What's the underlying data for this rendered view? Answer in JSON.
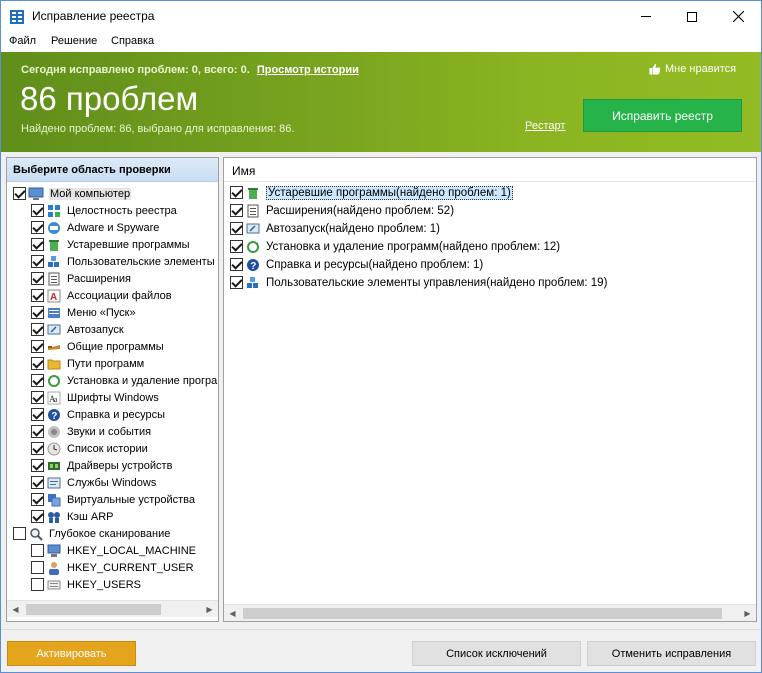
{
  "window": {
    "title": "Исправление реестра"
  },
  "menu": [
    "Файл",
    "Решение",
    "Справка"
  ],
  "banner": {
    "today_text": "Сегодня исправлено проблем: 0, всего: 0.",
    "history_link": "Просмотр истории",
    "problem_count": "86 проблем",
    "found_text": "Найдено проблем: 86, выбрано для исправления: 86.",
    "like_label": "Мне нравится",
    "restart_link": "Рестарт",
    "fix_button": "Исправить реестр"
  },
  "left_panel": {
    "header": "Выберите область проверки",
    "root": {
      "label": "Мой компьютер",
      "checked": true,
      "icon": "computer-icon"
    },
    "items": [
      {
        "label": "Целостность реестра",
        "checked": true,
        "icon": "registry-icon"
      },
      {
        "label": "Adware и Spyware",
        "checked": true,
        "icon": "adware-icon"
      },
      {
        "label": "Устаревшие программы",
        "checked": true,
        "icon": "trash-icon"
      },
      {
        "label": "Пользовательские элементы у",
        "checked": true,
        "icon": "blocks-icon"
      },
      {
        "label": "Расширения",
        "checked": true,
        "icon": "extensions-icon"
      },
      {
        "label": "Ассоциации файлов",
        "checked": true,
        "icon": "file-association-icon"
      },
      {
        "label": "Меню «Пуск»",
        "checked": true,
        "icon": "start-menu-icon"
      },
      {
        "label": "Автозапуск",
        "checked": true,
        "icon": "autorun-icon"
      },
      {
        "label": "Общие программы",
        "checked": true,
        "icon": "shared-programs-icon"
      },
      {
        "label": "Пути программ",
        "checked": true,
        "icon": "folder-icon"
      },
      {
        "label": "Установка и удаление програ",
        "checked": true,
        "icon": "recycle-icon"
      },
      {
        "label": "Шрифты Windows",
        "checked": true,
        "icon": "fonts-icon"
      },
      {
        "label": "Справка и ресурсы",
        "checked": true,
        "icon": "help-icon"
      },
      {
        "label": "Звуки и события",
        "checked": true,
        "icon": "sound-icon"
      },
      {
        "label": "Список истории",
        "checked": true,
        "icon": "history-icon"
      },
      {
        "label": "Драйверы устройств",
        "checked": true,
        "icon": "driver-icon"
      },
      {
        "label": "Службы Windows",
        "checked": true,
        "icon": "services-icon"
      },
      {
        "label": "Виртуальные устройства",
        "checked": true,
        "icon": "virtual-device-icon"
      },
      {
        "label": "Кэш ARP",
        "checked": true,
        "icon": "arp-cache-icon"
      }
    ],
    "deep_scan": {
      "label": "Глубокое сканирование",
      "checked": false,
      "icon": "deep-scan-icon"
    },
    "deep_items": [
      {
        "label": "HKEY_LOCAL_MACHINE",
        "checked": false,
        "icon": "local-machine-icon"
      },
      {
        "label": "HKEY_CURRENT_USER",
        "checked": false,
        "icon": "current-user-icon"
      },
      {
        "label": "HKEY_USERS",
        "checked": false,
        "icon": "users-icon"
      }
    ]
  },
  "right_panel": {
    "column_header": "Имя",
    "results": [
      {
        "label": "Устаревшие программы(найдено проблем: 1)",
        "checked": true,
        "icon": "trash-icon",
        "selected": true
      },
      {
        "label": "Расширения(найдено проблем: 52)",
        "checked": true,
        "icon": "extensions-icon",
        "selected": false
      },
      {
        "label": "Автозапуск(найдено проблем: 1)",
        "checked": true,
        "icon": "autorun-icon",
        "selected": false
      },
      {
        "label": "Установка и удаление программ(найдено проблем: 12)",
        "checked": true,
        "icon": "recycle-icon",
        "selected": false
      },
      {
        "label": "Справка и ресурсы(найдено проблем: 1)",
        "checked": true,
        "icon": "help-icon",
        "selected": false
      },
      {
        "label": "Пользовательские элементы управления(найдено проблем: 19)",
        "checked": true,
        "icon": "blocks-icon",
        "selected": false
      }
    ]
  },
  "bottom": {
    "activate": "Активировать",
    "exclusions": "Список исключений",
    "undo": "Отменить исправления"
  },
  "colors": {
    "banner_start": "#5f8e1a",
    "banner_end": "#93bb24",
    "fix_button": "#26b34a",
    "activate_button": "#e4a41c",
    "selection": "#cce8ff"
  }
}
